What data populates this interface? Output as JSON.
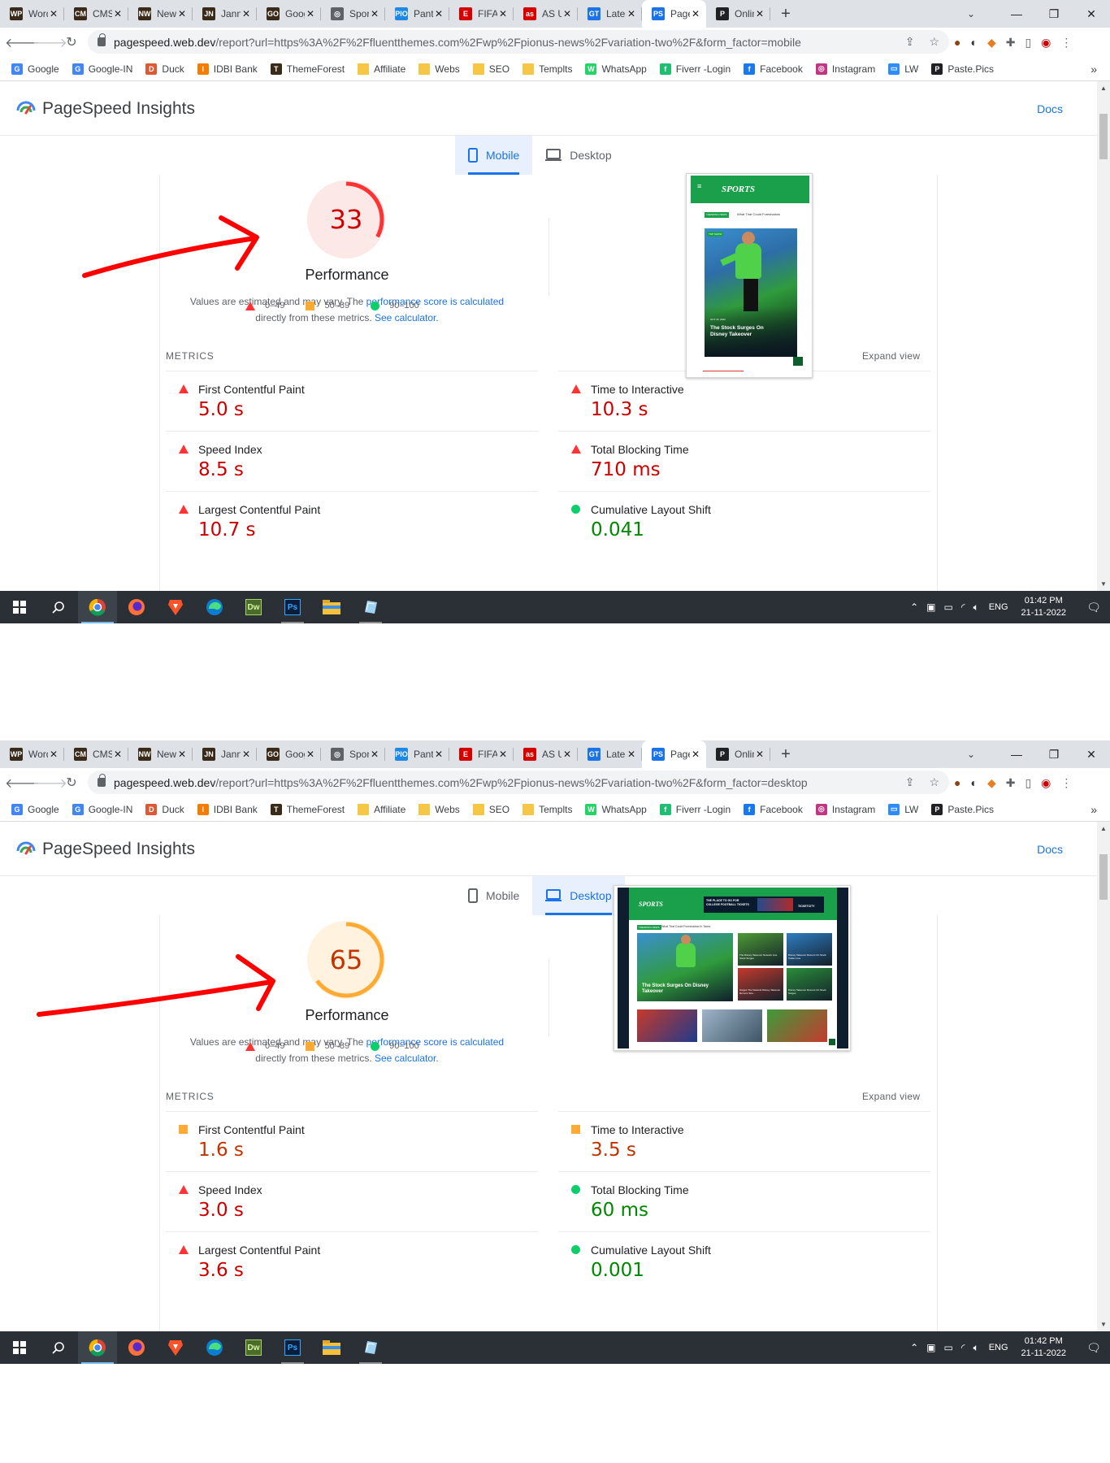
{
  "browser": {
    "tabs": [
      {
        "title": "Word",
        "fav": "WP",
        "color": "#3a2a1a"
      },
      {
        "title": "CMS",
        "fav": "CM",
        "color": "#3a2a1a"
      },
      {
        "title": "News",
        "fav": "NW",
        "color": "#3a2a1a"
      },
      {
        "title": "Janni",
        "fav": "JN",
        "color": "#3a2a1a"
      },
      {
        "title": "Goog",
        "fav": "GO",
        "color": "#3a2a1a"
      },
      {
        "title": "Sport",
        "fav": "◎",
        "color": "#5f6368"
      },
      {
        "title": "Panto",
        "fav": "PIO",
        "color": "#1e88e5"
      },
      {
        "title": "FIFA",
        "fav": "E",
        "color": "#d50000"
      },
      {
        "title": "AS U",
        "fav": "as",
        "color": "#d50000"
      },
      {
        "title": "Lates",
        "fav": "GT",
        "color": "#1a73e8"
      },
      {
        "title": "Page",
        "fav": "PS",
        "color": "#1a73e8",
        "active": true
      },
      {
        "title": "Onlin",
        "fav": "P",
        "color": "#202124"
      }
    ],
    "new_tab_label": "+",
    "window_controls": {
      "tab_search": "⌄",
      "minimize": "—",
      "restore": "❐",
      "close": "✕"
    },
    "url_host": "pagespeed.web.dev",
    "bookmarks": [
      {
        "label": "Google",
        "fav": "G",
        "color": "#4285f4"
      },
      {
        "label": "Google-IN",
        "fav": "G",
        "color": "#4285f4"
      },
      {
        "label": "Duck",
        "fav": "D",
        "color": "#de5833"
      },
      {
        "label": "IDBI Bank",
        "fav": "I",
        "color": "#f57c00"
      },
      {
        "label": "ThemeForest",
        "fav": "T",
        "color": "#3a2a1a"
      },
      {
        "label": "Affiliate",
        "fav": "",
        "color": "#f6c744"
      },
      {
        "label": "Webs",
        "fav": "",
        "color": "#f6c744"
      },
      {
        "label": "SEO",
        "fav": "",
        "color": "#f6c744"
      },
      {
        "label": "Templts",
        "fav": "",
        "color": "#f6c744"
      },
      {
        "label": "WhatsApp",
        "fav": "W",
        "color": "#25d366"
      },
      {
        "label": "Fiverr -Login",
        "fav": "f",
        "color": "#1dbf73"
      },
      {
        "label": "Facebook",
        "fav": "f",
        "color": "#1877f2"
      },
      {
        "label": "Instagram",
        "fav": "◎",
        "color": "#c13584"
      },
      {
        "label": "LW",
        "fav": "▭",
        "color": "#2d8cff"
      },
      {
        "label": "Paste.Pics",
        "fav": "P",
        "color": "#202124"
      }
    ],
    "bookmarks_more": "»"
  },
  "psi": {
    "title": "PageSpeed Insights",
    "docs": "Docs",
    "tab_mobile": "Mobile",
    "tab_desktop": "Desktop",
    "perf_label": "Performance",
    "desc_pre": "Values are estimated and may vary. The ",
    "desc_link1": "performance score is calculated",
    "desc_mid": " directly from these metrics. ",
    "desc_link2": "See calculator.",
    "legend": [
      "0–49",
      "50–89",
      "90–100"
    ],
    "metrics_heading": "METRICS",
    "expand_view": "Expand view"
  },
  "taskbar": {
    "lang": "ENG",
    "time": "01:42 PM",
    "date": "21-11-2022",
    "apps": [
      "start",
      "search",
      "chrome",
      "firefox",
      "brave",
      "edge",
      "dreamweaver",
      "photoshop",
      "explorer",
      "notepad"
    ]
  },
  "reports": [
    {
      "url_path": "/report?url=https%3A%2F%2Ffluentthemes.com%2Fwp%2Fpionus-news%2Fvariation-two%2F&form_factor=mobile",
      "form_factor": "mobile",
      "score": 33,
      "score_color": "#cc0000",
      "ring_color": "#ff3333",
      "ring_bg": "#fde8e8",
      "metrics": [
        {
          "label": "First Contentful Paint",
          "value": "5.0 s",
          "status": "fail"
        },
        {
          "label": "Time to Interactive",
          "value": "10.3 s",
          "status": "fail"
        },
        {
          "label": "Speed Index",
          "value": "8.5 s",
          "status": "fail"
        },
        {
          "label": "Total Blocking Time",
          "value": "710 ms",
          "status": "fail"
        },
        {
          "label": "Largest Contentful Paint",
          "value": "10.7 s",
          "status": "fail"
        },
        {
          "label": "Cumulative Layout Shift",
          "value": "0.041",
          "status": "pass"
        }
      ],
      "preview": {
        "logo": "SPORTS",
        "badge": "TRENDING NEWS",
        "ticker": "What That Could Foreshadow",
        "hero_tag": "TOP SHOW",
        "hero_date": "OCT 15, 2022",
        "hero_title": "The Stock Surges On Disney Takeover"
      }
    },
    {
      "url_path": "/report?url=https%3A%2F%2Ffluentthemes.com%2Fwp%2Fpionus-news%2Fvariation-two%2F&form_factor=desktop",
      "form_factor": "desktop",
      "score": 65,
      "score_color": "#c33300",
      "ring_color": "#ffaa33",
      "ring_bg": "#fff3e0",
      "metrics": [
        {
          "label": "First Contentful Paint",
          "value": "1.6 s",
          "status": "average"
        },
        {
          "label": "Time to Interactive",
          "value": "3.5 s",
          "status": "average"
        },
        {
          "label": "Speed Index",
          "value": "3.0 s",
          "status": "fail"
        },
        {
          "label": "Total Blocking Time",
          "value": "60 ms",
          "status": "pass"
        },
        {
          "label": "Largest Contentful Paint",
          "value": "3.6 s",
          "status": "fail"
        },
        {
          "label": "Cumulative Layout Shift",
          "value": "0.001",
          "status": "pass"
        }
      ],
      "preview": {
        "logo": "SPORTS",
        "ad_text": "THE PLACE TO GO FOR COLLEGE FOOTBALL TICKETS",
        "ad_brand": "TICKETCITY",
        "badge": "TRENDING NEWS",
        "ticker": "What That Could Foreshadow In Taxes",
        "hero_title": "The Stock Surges On Disney Takeover",
        "thumbs": [
          "The Disney Takeover Network Live Stock Surges",
          "Disney Takeover Rumors On Stock Twitter Live",
          "Surges The Network Disney Takeover Rumors Stre...",
          "Disney Takeover Rumors On Stock Surges"
        ]
      }
    }
  ]
}
